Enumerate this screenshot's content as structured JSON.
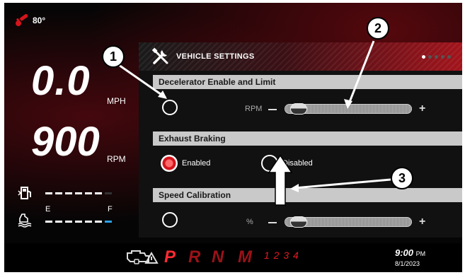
{
  "status": {
    "temperature": "80°"
  },
  "dash": {
    "speed_value": "0.0",
    "speed_unit": "MPH",
    "rpm_value": "900",
    "rpm_unit": "RPM",
    "fluid_empty_label": "E",
    "fluid_full_label": "F",
    "fuel_level": 0.9,
    "def_level": 1.0,
    "colors": {
      "fuel_end": "#c8202a",
      "def_end": "#2aa3e8"
    }
  },
  "settings": {
    "title": "VEHICLE SETTINGS",
    "page_indicator": {
      "total": 5,
      "active": 1
    },
    "decelerator": {
      "header": "Decelerator Enable and Limit",
      "unit": "RPM",
      "slider_value_fraction": 0.05
    },
    "exhaust": {
      "header": "Exhaust Braking",
      "enabled_label": "Enabled",
      "disabled_label": "Disabled",
      "selected": "Enabled"
    },
    "speed_cal": {
      "header": "Speed Calibration",
      "unit": "%",
      "slider_value_fraction": 0.05
    }
  },
  "bottom": {
    "gears": [
      "P",
      "R",
      "N",
      "M"
    ],
    "gear_numbers": "1 2 3 4",
    "time": "9:00",
    "ampm": "PM",
    "date": "8/1/2023"
  },
  "callouts": [
    "1",
    "2",
    "3"
  ],
  "colors": {
    "accent_red": "#d4141c",
    "panel_header": "#c9c9c9"
  }
}
